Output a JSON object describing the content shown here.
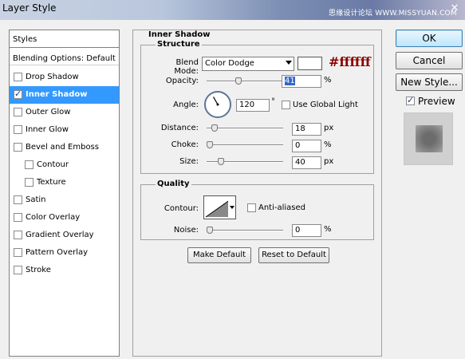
{
  "window": {
    "title": "Layer Style",
    "watermark": "思缘设计论坛 WWW.MISSYUAN.COM",
    "close_glyph": "✕"
  },
  "styles_panel": {
    "header": "Styles",
    "blending_options": "Blending Options: Default",
    "items": [
      {
        "label": "Drop Shadow",
        "checked": false,
        "selected": false,
        "sub": false
      },
      {
        "label": "Inner Shadow",
        "checked": true,
        "selected": true,
        "sub": false
      },
      {
        "label": "Outer Glow",
        "checked": false,
        "selected": false,
        "sub": false
      },
      {
        "label": "Inner Glow",
        "checked": false,
        "selected": false,
        "sub": false
      },
      {
        "label": "Bevel and Emboss",
        "checked": false,
        "selected": false,
        "sub": false
      },
      {
        "label": "Contour",
        "checked": false,
        "selected": false,
        "sub": true
      },
      {
        "label": "Texture",
        "checked": false,
        "selected": false,
        "sub": true
      },
      {
        "label": "Satin",
        "checked": false,
        "selected": false,
        "sub": false
      },
      {
        "label": "Color Overlay",
        "checked": false,
        "selected": false,
        "sub": false
      },
      {
        "label": "Gradient Overlay",
        "checked": false,
        "selected": false,
        "sub": false
      },
      {
        "label": "Pattern Overlay",
        "checked": false,
        "selected": false,
        "sub": false
      },
      {
        "label": "Stroke",
        "checked": false,
        "selected": false,
        "sub": false
      }
    ]
  },
  "inner_shadow": {
    "section_title": "Inner Shadow",
    "structure": {
      "title": "Structure",
      "blend_mode_label": "Blend Mode:",
      "blend_mode_value": "Color Dodge",
      "color_hex_label": "#ffffff",
      "swatch_color": "#ffffff",
      "opacity_label": "Opacity:",
      "opacity_value": "41",
      "opacity_unit": "%",
      "opacity_fraction": 0.41,
      "angle_label": "Angle:",
      "angle_value": "120",
      "angle_unit": "°",
      "use_global_light_label": "Use Global Light",
      "use_global_light": false,
      "distance_label": "Distance:",
      "distance_value": "18",
      "distance_unit": "px",
      "distance_fraction": 0.07,
      "choke_label": "Choke:",
      "choke_value": "0",
      "choke_unit": "%",
      "choke_fraction": 0.0,
      "size_label": "Size:",
      "size_value": "40",
      "size_unit": "px",
      "size_fraction": 0.16
    },
    "quality": {
      "title": "Quality",
      "contour_label": "Contour:",
      "anti_aliased_label": "Anti-aliased",
      "anti_aliased": false,
      "noise_label": "Noise:",
      "noise_value": "0",
      "noise_unit": "%",
      "noise_fraction": 0.0
    },
    "make_default_label": "Make Default",
    "reset_default_label": "Reset to Default"
  },
  "actions": {
    "ok_label": "OK",
    "cancel_label": "Cancel",
    "new_style_label": "New Style...",
    "preview_label": "Preview",
    "preview_checked": true
  },
  "colors": {
    "selection": "#3399ff",
    "hex_text": "#8b0000"
  }
}
